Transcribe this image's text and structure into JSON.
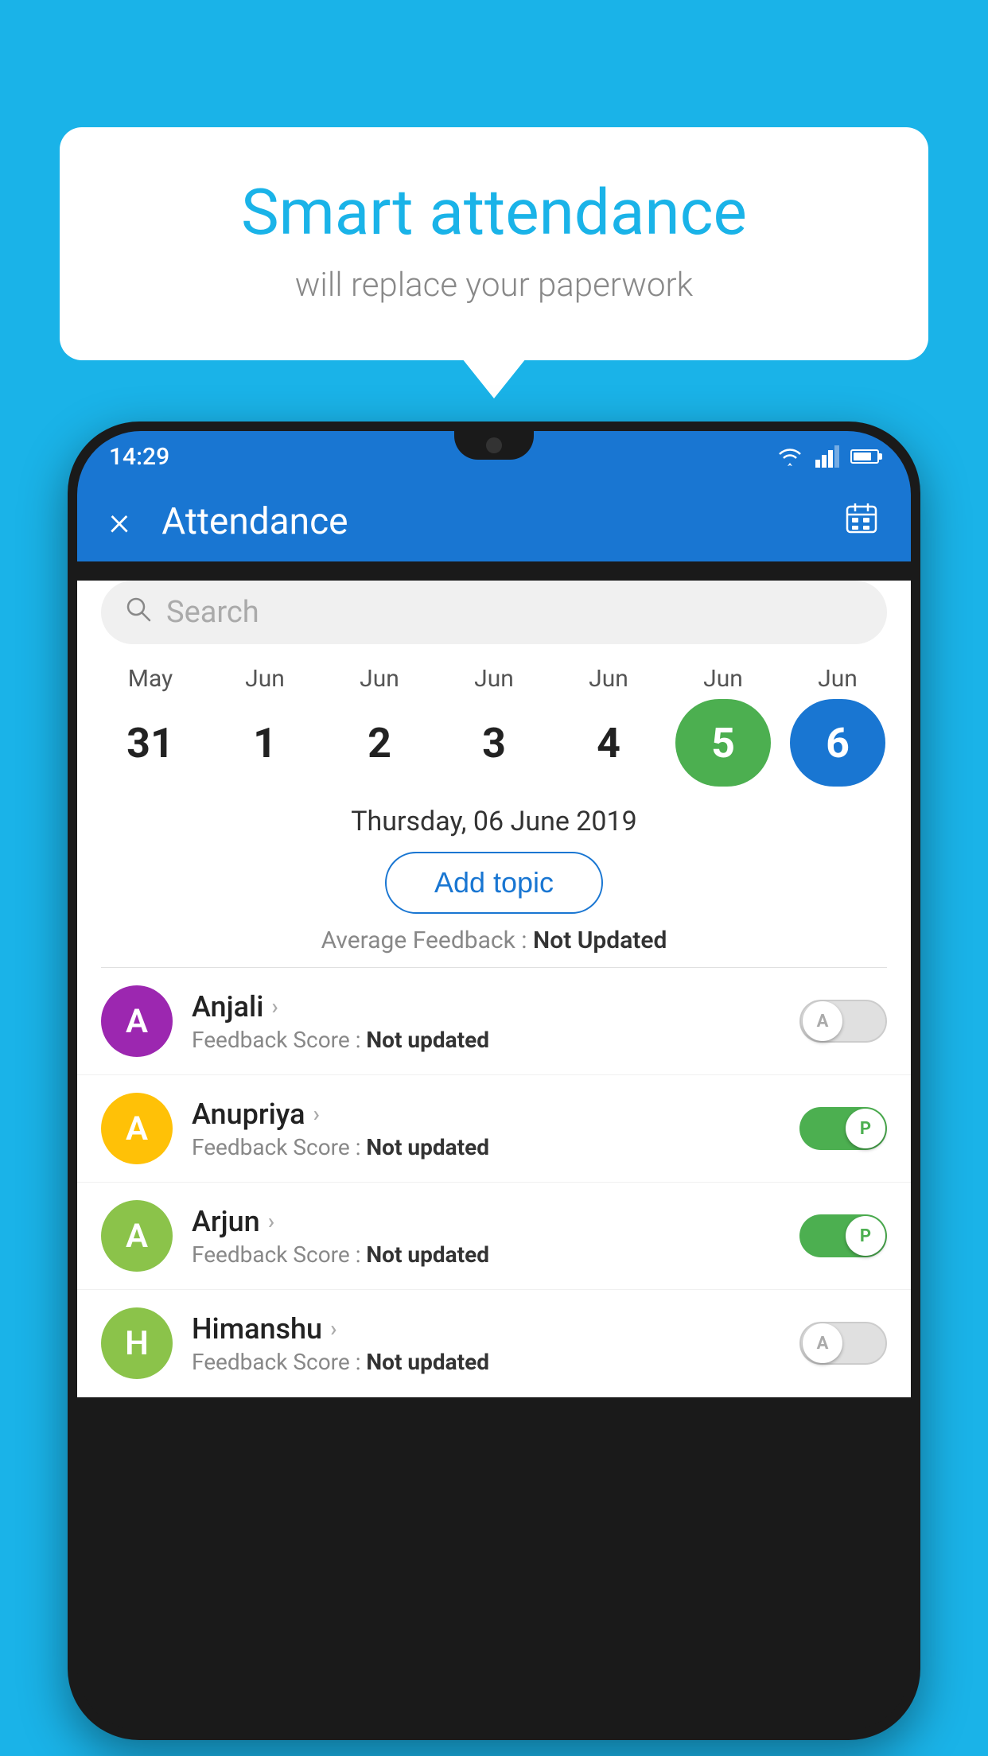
{
  "background_color": "#1ab3e8",
  "bubble": {
    "title": "Smart attendance",
    "subtitle": "will replace your paperwork"
  },
  "status_bar": {
    "time": "14:29",
    "icons": [
      "wifi",
      "signal",
      "battery"
    ]
  },
  "header": {
    "close_label": "×",
    "title": "Attendance",
    "calendar_icon": "📅"
  },
  "search": {
    "placeholder": "Search"
  },
  "calendar": {
    "months": [
      "May",
      "Jun",
      "Jun",
      "Jun",
      "Jun",
      "Jun",
      "Jun"
    ],
    "dates": [
      "31",
      "1",
      "2",
      "3",
      "4",
      "5",
      "6"
    ],
    "today_index": 5,
    "selected_index": 6
  },
  "selected_date": "Thursday, 06 June 2019",
  "add_topic_label": "Add topic",
  "avg_feedback": {
    "label": "Average Feedback : ",
    "value": "Not Updated"
  },
  "students": [
    {
      "name": "Anjali",
      "avatar_letter": "A",
      "avatar_color": "#9c27b0",
      "feedback": "Feedback Score : ",
      "feedback_value": "Not updated",
      "toggle": "off",
      "toggle_letter": "A"
    },
    {
      "name": "Anupriya",
      "avatar_letter": "A",
      "avatar_color": "#ffc107",
      "feedback": "Feedback Score : ",
      "feedback_value": "Not updated",
      "toggle": "on",
      "toggle_letter": "P"
    },
    {
      "name": "Arjun",
      "avatar_letter": "A",
      "avatar_color": "#8bc34a",
      "feedback": "Feedback Score : ",
      "feedback_value": "Not updated",
      "toggle": "on",
      "toggle_letter": "P"
    },
    {
      "name": "Himanshu",
      "avatar_letter": "H",
      "avatar_color": "#8bc34a",
      "feedback": "Feedback Score : ",
      "feedback_value": "Not updated",
      "toggle": "off",
      "toggle_letter": "A"
    }
  ]
}
